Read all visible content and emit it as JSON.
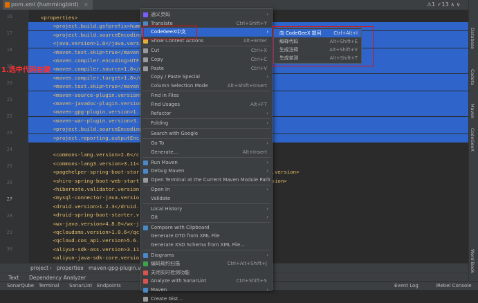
{
  "tab": {
    "label": "pom.xml (hummingbird)",
    "close": "×"
  },
  "inspection": "⚠1 ✓13 ∧ ∨",
  "gutter": {
    "lines": [
      "16",
      "17",
      "18",
      "19",
      "20",
      "21",
      "22",
      "23",
      "24",
      "25",
      "26",
      "27",
      "28",
      "29",
      "30"
    ],
    "current": "27"
  },
  "code": {
    "lines": [
      {
        "text": "    <properties>",
        "sel": false
      },
      {
        "text": "        <project.build.gsfprefix>hummingbird",
        "sel": true
      },
      {
        "text": "        <project.build.sourceEncoding",
        "sel": true
      },
      {
        "text": "        <java.version>1.8</java.version>",
        "sel": true
      },
      {
        "text": "        <maven.test.skip>true</maven.test.skip>",
        "sel": true
      },
      {
        "text": "        <maven.compiler.encoding>UTF-8",
        "sel": true
      },
      {
        "text": "        <maven.compiler.source>1.8</maven.compiler.source>",
        "sel": true
      },
      {
        "text": "        <maven.compiler.target>1.8</maven.compiler.target>",
        "sel": true
      },
      {
        "text": "        <maven.test.skip>true</maven.test.skip>",
        "sel": true
      },
      {
        "text": "        <maven-source-plugin.version>",
        "sel": true
      },
      {
        "text": "        <maven-javadoc-plugin.version>",
        "sel": true
      },
      {
        "text": "        <maven-gpg-plugin.version>1.",
        "sel": true
      },
      {
        "text": "        <maven-war-plugin.version>3.",
        "sel": true
      },
      {
        "text": "        <project.build.sourceEncoding",
        "sel": true
      },
      {
        "text": "        <project.reporting.outputEnc                                   ding>",
        "sel": true
      },
      {
        "text": "",
        "sel": false
      },
      {
        "text": "        <commons-lang.version>2.6</c",
        "sel": false
      },
      {
        "text": "        <commons-lang3.version>3.11<",
        "sel": false
      },
      {
        "text": "        <pagehelper-spring-boot-star                                    starter.version>",
        "sel": false
      },
      {
        "text": "        <shiro-spring-boot-web-start                                   rter.version>",
        "sel": false
      },
      {
        "text": "        <hibernate.validator.version",
        "sel": false
      },
      {
        "text": "        <mysql-connector-java.versio",
        "sel": false
      },
      {
        "text": "        <druid.version>1.2.3</druid.",
        "sel": false
      },
      {
        "text": "        <druid-spring-boot-starter.v                     on>",
        "sel": false
      },
      {
        "text": "        <wx-java.version>4.8.0</wx-j",
        "sel": false
      },
      {
        "text": "        <qcloudsms.version>1.0.6</qc",
        "sel": false
      },
      {
        "text": "        <qcloud.cos_api.version>5.6.",
        "sel": false
      },
      {
        "text": "        <aliyun-sdk-oss.version>3.11",
        "sel": false
      },
      {
        "text": "        <aliyun-java-sdk-core.versio",
        "sel": false
      }
    ]
  },
  "annotations": {
    "a1": "1.选中代码右键",
    "a2": "2",
    "a3": "3"
  },
  "menu": {
    "items": [
      {
        "label": "通义灵码",
        "sc": "",
        "arrow": true,
        "icon": "#7b5cff",
        "hl": false,
        "sepAfter": false
      },
      {
        "label": "Translate",
        "sc": "Ctrl+Shift+Y",
        "arrow": false,
        "icon": "#4a88c7",
        "hl": false,
        "sepAfter": false
      },
      {
        "label": "CodeGeeX中文",
        "sc": "",
        "arrow": true,
        "icon": "",
        "hl": true,
        "sepAfter": false
      },
      {
        "label": "Show Context Actions",
        "sc": "Alt+Enter",
        "arrow": false,
        "icon": "#e2b03a",
        "hl": false,
        "sepAfter": true
      },
      {
        "label": "Cut",
        "sc": "Ctrl+X",
        "arrow": false,
        "icon": "#9a9a9a",
        "hl": false,
        "sepAfter": false
      },
      {
        "label": "Copy",
        "sc": "Ctrl+C",
        "arrow": false,
        "icon": "#9a9a9a",
        "hl": false,
        "sepAfter": false
      },
      {
        "label": "Paste",
        "sc": "Ctrl+V",
        "arrow": false,
        "icon": "#9a9a9a",
        "hl": false,
        "sepAfter": false
      },
      {
        "label": "Copy / Paste Special",
        "sc": "",
        "arrow": true,
        "icon": "",
        "hl": false,
        "sepAfter": false
      },
      {
        "label": "Column Selection Mode",
        "sc": "Alt+Shift+Insert",
        "arrow": false,
        "icon": "",
        "hl": false,
        "sepAfter": true
      },
      {
        "label": "Find in Files",
        "sc": "",
        "arrow": false,
        "icon": "",
        "hl": false,
        "sepAfter": false
      },
      {
        "label": "Find Usages",
        "sc": "Alt+F7",
        "arrow": false,
        "icon": "",
        "hl": false,
        "sepAfter": false
      },
      {
        "label": "Refactor",
        "sc": "",
        "arrow": true,
        "icon": "",
        "hl": false,
        "sepAfter": true
      },
      {
        "label": "Folding",
        "sc": "",
        "arrow": true,
        "icon": "",
        "hl": false,
        "sepAfter": true
      },
      {
        "label": "Search with Google",
        "sc": "",
        "arrow": false,
        "icon": "",
        "hl": false,
        "sepAfter": true
      },
      {
        "label": "Go To",
        "sc": "",
        "arrow": true,
        "icon": "",
        "hl": false,
        "sepAfter": false
      },
      {
        "label": "Generate...",
        "sc": "Alt+Insert",
        "arrow": false,
        "icon": "",
        "hl": false,
        "sepAfter": true
      },
      {
        "label": "Run Maven",
        "sc": "",
        "arrow": true,
        "icon": "#4a88c7",
        "hl": false,
        "sepAfter": false
      },
      {
        "label": "Debug Maven",
        "sc": "",
        "arrow": true,
        "icon": "#4a88c7",
        "hl": false,
        "sepAfter": false
      },
      {
        "label": "Open Terminal at the Current Maven Module Path",
        "sc": "",
        "arrow": false,
        "icon": "#9a9a9a",
        "hl": false,
        "sepAfter": true
      },
      {
        "label": "Open In",
        "sc": "",
        "arrow": true,
        "icon": "",
        "hl": false,
        "sepAfter": false
      },
      {
        "label": "Validate",
        "sc": "",
        "arrow": false,
        "icon": "",
        "hl": false,
        "sepAfter": true
      },
      {
        "label": "Local History",
        "sc": "",
        "arrow": true,
        "icon": "",
        "hl": false,
        "sepAfter": false
      },
      {
        "label": "Git",
        "sc": "",
        "arrow": true,
        "icon": "",
        "hl": false,
        "sepAfter": true
      },
      {
        "label": "Compare with Clipboard",
        "sc": "",
        "arrow": false,
        "icon": "#4a88c7",
        "hl": false,
        "sepAfter": false
      },
      {
        "label": "Generate DTD from XML File",
        "sc": "",
        "arrow": false,
        "icon": "",
        "hl": false,
        "sepAfter": false
      },
      {
        "label": "Generate XSD Schema from XML File...",
        "sc": "",
        "arrow": false,
        "icon": "",
        "hl": false,
        "sepAfter": true
      },
      {
        "label": "Diagrams",
        "sc": "",
        "arrow": true,
        "icon": "#4a88c7",
        "hl": false,
        "sepAfter": false
      },
      {
        "label": "编码规约扫描",
        "sc": "Ctrl+Alt+Shift+J",
        "arrow": false,
        "icon": "#3fa34d",
        "hl": false,
        "sepAfter": false
      },
      {
        "label": "关闭实时检测功能",
        "sc": "",
        "arrow": false,
        "icon": "#d9534f",
        "hl": false,
        "sepAfter": false
      },
      {
        "label": "Analyze with SonarLint",
        "sc": "Ctrl+Shift+S",
        "arrow": false,
        "icon": "#d9534f",
        "hl": false,
        "sepAfter": false
      },
      {
        "label": "Maven",
        "sc": "",
        "arrow": true,
        "icon": "#4a88c7",
        "hl": false,
        "sepAfter": false
      },
      {
        "label": "Create Gist...",
        "sc": "",
        "arrow": false,
        "icon": "#9a9a9a",
        "hl": false,
        "sepAfter": false
      }
    ]
  },
  "submenu": {
    "items": [
      {
        "label": "向 CodeGeeX 提问",
        "sc": "Ctrl+Alt+I",
        "hl": true
      },
      {
        "label": "解释代码",
        "sc": "Alt+Shift+E",
        "hl": false
      },
      {
        "label": "生成注释",
        "sc": "Alt+Shift+V",
        "hl": false
      },
      {
        "label": "生成单测",
        "sc": "Alt+Shift+T",
        "hl": false
      }
    ]
  },
  "breadcrumb": {
    "items": [
      "project",
      "properties",
      "maven-gpg-plugin.ver"
    ]
  },
  "bottomTabs": {
    "text": "Text",
    "deps": "Dependency Analyzer"
  },
  "bottomTools": {
    "items": [
      "SonarQube",
      "Terminal",
      "SonarLint",
      "Endpoints",
      "Event Log",
      "iRebel Console"
    ]
  },
  "rightStrip": {
    "items": [
      "Database",
      "Codota",
      "Maven",
      "CodeGeeX",
      "Word Book"
    ]
  }
}
